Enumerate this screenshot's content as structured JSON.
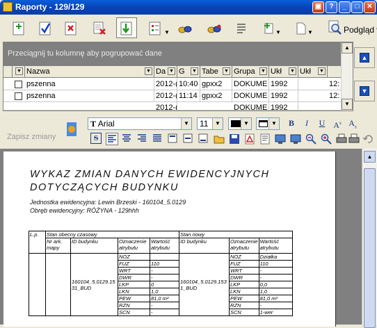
{
  "window": {
    "title": "Raporty - 129/129"
  },
  "toolbar": {
    "podglad_label": "Podgląd w"
  },
  "grid": {
    "group_hint": "Przeciągnij tu kolumnę aby pogrupować dane",
    "columns": [
      "Nazwa",
      "Da",
      "G",
      "Tabe",
      "Grupa",
      "Ukł",
      "Ukł"
    ],
    "rows": [
      [
        "pszenna",
        "2012-(",
        "10:40",
        "gpxx2",
        "DOKUME",
        "1992",
        "12:"
      ],
      [
        "pszenna",
        "2012-(",
        "11:14",
        "gpxx2",
        "DOKUME",
        "1992",
        "12:"
      ],
      [
        "",
        "2012-(",
        "",
        "",
        "DOKUME",
        "1992",
        ""
      ]
    ]
  },
  "format": {
    "save_label": "Zapisz zmiany",
    "font_name": "Arial",
    "font_size": "11",
    "font_color": "#000000"
  },
  "doc": {
    "title": "WYKAZ ZMIAN DANYCH EWIDENCYJNYCH DOTYCZĄCYCH BUDYNKU",
    "unit": "Jednostka ewidencyjna: Lewin Brzeski - 160104_5.0129",
    "area": "Obręb ewidencyjny: RÓŻYNA - 129hhh",
    "table": {
      "lp": "L.p.",
      "old_state": "Stan obecny czasowy",
      "new_state": "Stan nowy",
      "nr_mapy": "Nr ark. mapy",
      "id_bud": "ID budynku",
      "oznaczenie": "Oznaczenie atrybutu",
      "wartosc": "Wartość atrybutu",
      "old_id": "160104_5.0129.1531_BUD",
      "new_id": "160104_5.0129.1531_BUD",
      "attrs": [
        "NOZ",
        "FUZ",
        "WRT",
        "DWR",
        "LKP",
        "LKN",
        "PEW",
        "RZN",
        "SCN"
      ],
      "old_values": [
        "",
        "110",
        "-",
        "-",
        "0",
        "1,0",
        "81,0 m²",
        "-",
        "-"
      ],
      "new_values": [
        "Działka",
        "110",
        "-",
        "-",
        "0,0",
        "1,0",
        "81,0 m²",
        "-",
        "1-wer"
      ]
    }
  }
}
